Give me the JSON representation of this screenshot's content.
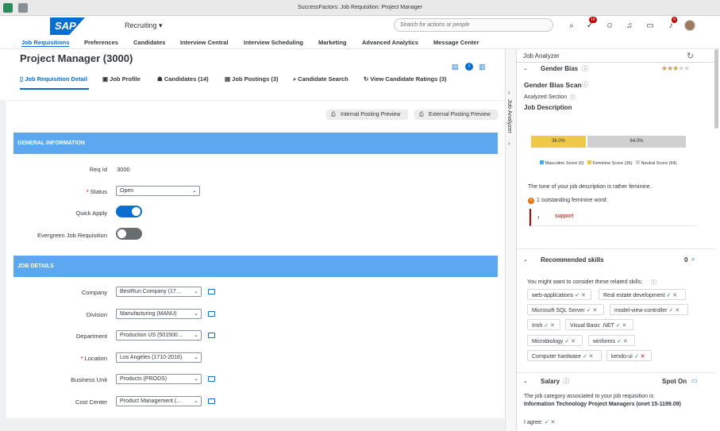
{
  "window": {
    "title": "SuccessFactors: Job Requisition: Project Manager"
  },
  "shell": {
    "logo": "SAP",
    "module": "Recruiting",
    "search_placeholder": "Search for actions or people",
    "badge_todo": "10",
    "badge_notif": "9"
  },
  "nav": [
    "Job Requisitions",
    "Preferences",
    "Candidates",
    "Interview Central",
    "Interview Scheduling",
    "Marketing",
    "Advanced Analytics",
    "Message Center"
  ],
  "page": {
    "title": "Project Manager (3000)"
  },
  "tabs": [
    "Job Requisition Detail",
    "Job Profile",
    "Candidates (14)",
    "Job Postings (3)",
    "Candidate Search",
    "View Candidate Ratings (3)"
  ],
  "buttons": {
    "internal": "Internal Posting Preview",
    "external": "External Posting Preview"
  },
  "general": {
    "header": "GENERAL INFORMATION",
    "req_id_label": "Req Id",
    "req_id": "3000",
    "status_label": "Status",
    "status": "Open",
    "quick_apply_label": "Quick Apply",
    "evergreen_label": "Evergreen Job Requisition"
  },
  "details": {
    "header": "JOB DETAILS",
    "rows": [
      {
        "label": "Company",
        "value": "BestRun Company (17…"
      },
      {
        "label": "Division",
        "value": "Manufacturing (MANU)"
      },
      {
        "label": "Department",
        "value": "Production US (501500…"
      },
      {
        "label": "Location",
        "value": "Los Angeles (1710-2016)"
      },
      {
        "label": "Business Unit",
        "value": "Products (PRODS)"
      },
      {
        "label": "Cost Center",
        "value": "Product Management (…"
      }
    ]
  },
  "analyzer": {
    "tab_label": "Job Analyzer",
    "title": "Job Analyzer",
    "gender_bias": "Gender Bias",
    "scan_title": "Gender Bias Scan",
    "analyzed_section": "Analyzed Section",
    "section_name": "Job Description",
    "bar": {
      "masculine": 0,
      "feminine": 36.0,
      "neutral": 64.0,
      "feminine_label": "36.0%",
      "neutral_label": "64.0%"
    },
    "legend": [
      "Masculine Score (0)",
      "Feminine Score (36)",
      "Neutral Score (64)"
    ],
    "colors": {
      "masculine": "#3fa9f5",
      "feminine": "#f0c94a",
      "neutral": "#d0d0d0"
    },
    "tone": "The tone of your job description is rather feminine.",
    "outstanding": "1 outstanding feminine word:",
    "word": "support",
    "recommended": "Recommended skills",
    "recommended_count": "0",
    "consider": "You might want to consider these related skills:",
    "skills": [
      "web-applications",
      "Real estate development",
      "Microsoft SQL Server",
      "model-view-controller",
      "Irish",
      "Visual Basic .NET",
      "Microbiology",
      "winforms",
      "Computer hardware",
      "kendo-ui"
    ],
    "salary": "Salary",
    "spot_on": "Spot On",
    "salary_text": "The job category associated to your job requisition is:",
    "salary_cat": "Information Technology Project Managers (onet 15-1199.09)",
    "agree": "I agree:"
  }
}
